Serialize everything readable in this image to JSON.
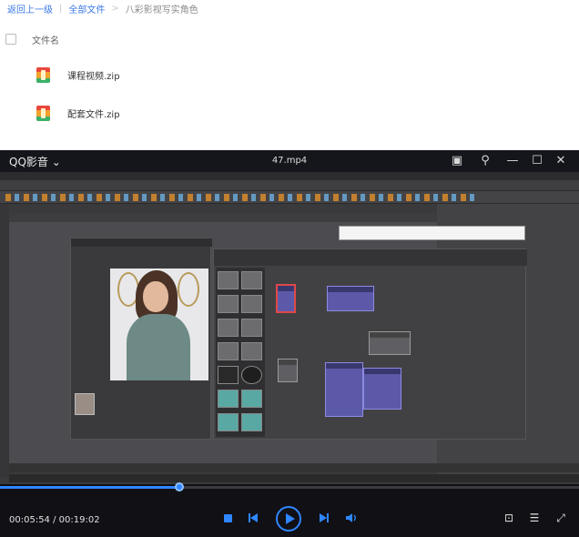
{
  "breadcrumb": {
    "back": "返回上一级",
    "all_files": "全部文件",
    "current": "八彩影视写实角色"
  },
  "file_list": {
    "column_name": "文件名",
    "files": [
      {
        "name": "课程视频.zip",
        "icon": "zip-archive-icon"
      },
      {
        "name": "配套文件.zip",
        "icon": "zip-archive-icon"
      }
    ]
  },
  "player": {
    "app_name": "QQ影音",
    "file_title": "47.mp4",
    "window_buttons": [
      "mini-mode-icon",
      "pin-icon",
      "minimize-icon",
      "maximize-icon",
      "close-icon"
    ],
    "current_time": "00:05:54",
    "total_time": "00:19:02",
    "time_display": "00:05:54 / 00:19:02",
    "progress": 0.31,
    "accent_color": "#2f86ff",
    "controls": [
      "stop-icon",
      "previous-icon",
      "play-icon",
      "next-icon",
      "volume-icon"
    ],
    "tools": [
      "screenshot-icon",
      "settings-icon",
      "fullscreen-icon"
    ]
  }
}
